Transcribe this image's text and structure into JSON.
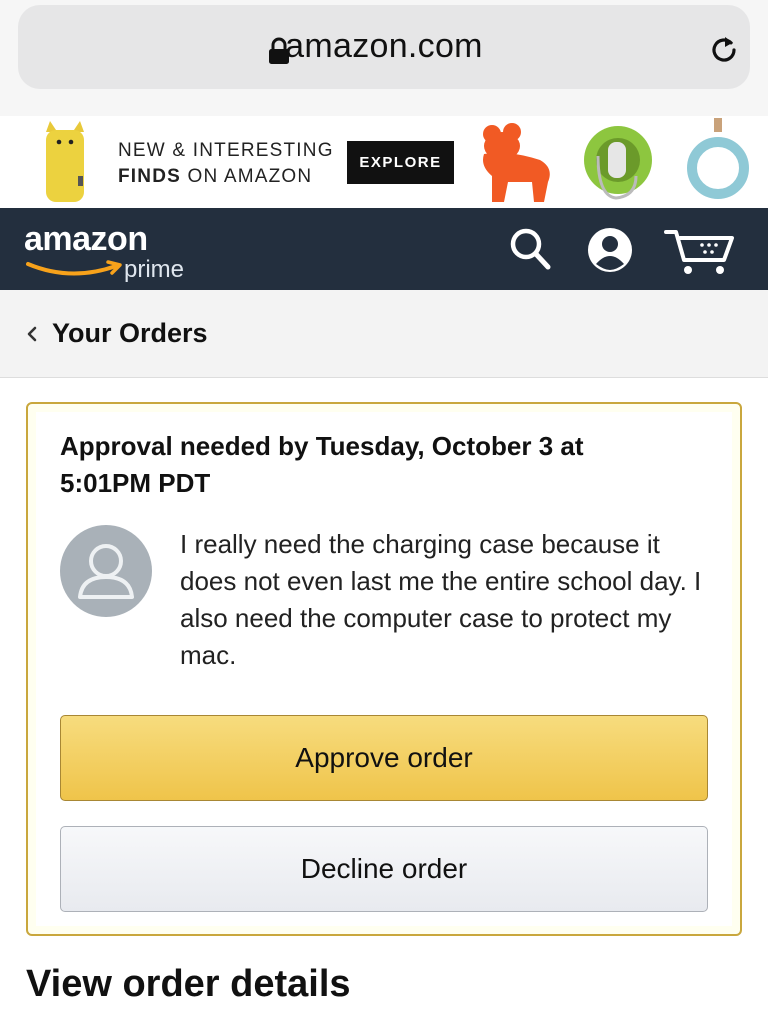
{
  "browser": {
    "host": "amazon.com",
    "icons": [
      "lock-icon",
      "reload-icon"
    ]
  },
  "promo": {
    "line1": "NEW & INTERESTING",
    "line2_a": "FINDS",
    "line2_b": "ON AMAZON",
    "cta": "EXPLORE"
  },
  "header": {
    "logo": "amazon",
    "logo_sub": "prime",
    "icons": [
      "search-icon",
      "account-icon",
      "cart-icon"
    ]
  },
  "nav": {
    "back_label": "Your Orders"
  },
  "approval": {
    "title": "Approval needed by Tuesday, October 3 at 5:01PM PDT",
    "message": "I really need the charging case because it does not even last me the entire school day. I also need the computer case to protect my mac.",
    "approve_label": "Approve order",
    "decline_label": "Decline order"
  },
  "details": {
    "heading": "View order details"
  },
  "colors": {
    "header_bg": "#232f3e",
    "approve_button": "#efc44a",
    "card_border": "#c9a73d"
  }
}
